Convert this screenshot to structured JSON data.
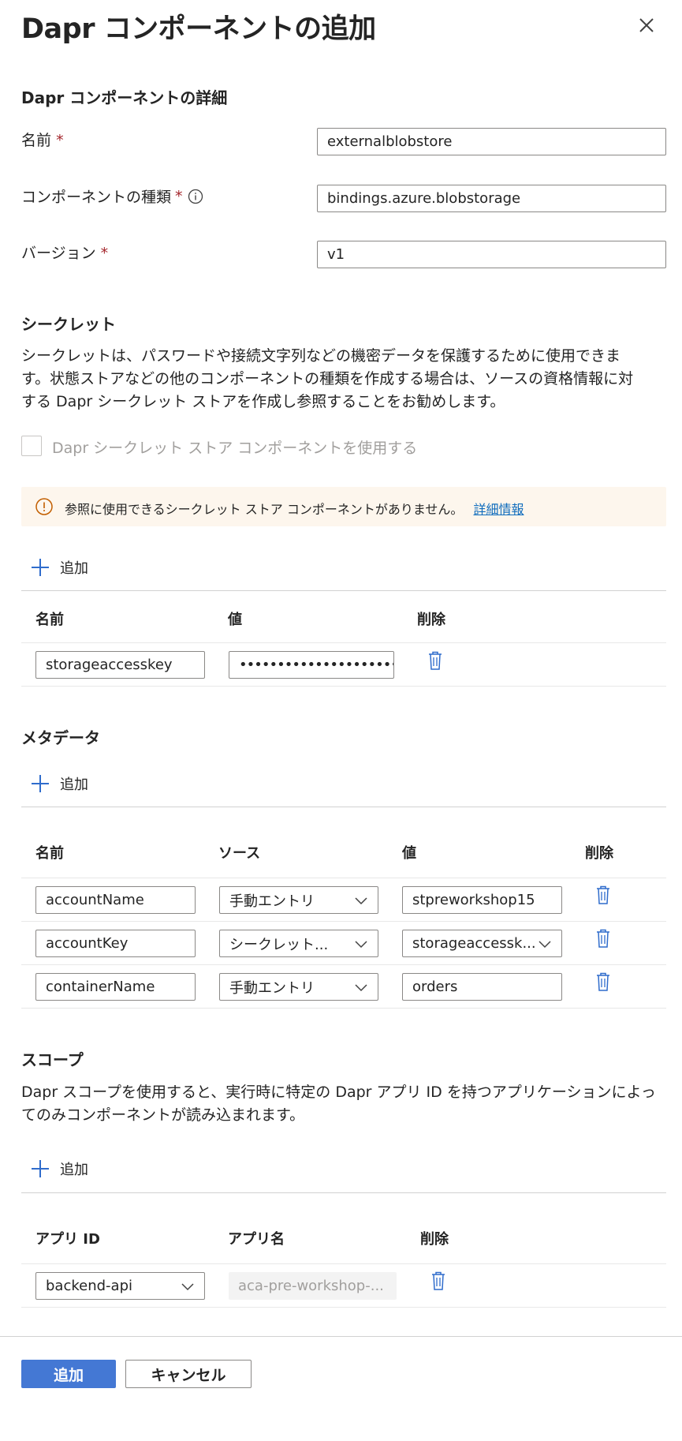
{
  "panel": {
    "title": "Dapr コンポーネントの追加"
  },
  "details": {
    "heading": "Dapr コンポーネントの詳細",
    "name_label": "名前",
    "name_value": "externalblobstore",
    "type_label": "コンポーネントの種類",
    "type_value": "bindings.azure.blobstorage",
    "version_label": "バージョン",
    "version_value": "v1",
    "required_mark": "*"
  },
  "secrets": {
    "heading": "シークレット",
    "desc_line1": "シークレットは、パスワードや接続文字列などの機密データを保護するために使用できま",
    "desc_line2": "す。状態ストアなどの他のコンポーネントの種類を作成する場合は、ソースの資格情報に対",
    "desc_line3": "する Dapr シークレット ストアを作成し参照することをお勧めします。",
    "checkbox_label": "Dapr シークレット ストア コンポーネントを使用する",
    "warning_text": "参照に使用できるシークレット ストア コンポーネントがありません。",
    "warning_link": "詳細情報",
    "add_label": "追加",
    "col_name": "名前",
    "col_value": "値",
    "col_delete": "削除",
    "rows": [
      {
        "name": "storageaccesskey",
        "value": "••••••••••••••••••••••..."
      }
    ]
  },
  "metadata": {
    "heading": "メタデータ",
    "add_label": "追加",
    "col_name": "名前",
    "col_source": "ソース",
    "col_value": "値",
    "col_delete": "削除",
    "rows": [
      {
        "name": "accountName",
        "source": "手動エントリ",
        "value": "stpreworkshop15"
      },
      {
        "name": "accountKey",
        "source": "シークレット...",
        "value": "storageaccessk..."
      },
      {
        "name": "containerName",
        "source": "手動エントリ",
        "value": "orders"
      }
    ]
  },
  "scope": {
    "heading": "スコープ",
    "desc_line1": "Dapr スコープを使用すると、実行時に特定の Dapr アプリ ID を持つアプリケーションによっ",
    "desc_line2": "てのみコンポーネントが読み込まれます。",
    "add_label": "追加",
    "col_app_id": "アプリ ID",
    "col_app_name": "アプリ名",
    "col_delete": "削除",
    "rows": [
      {
        "app_id": "backend-api",
        "app_name": "aca-pre-workshop-..."
      }
    ]
  },
  "footer": {
    "primary_label": "追加",
    "secondary_label": "キャンセル"
  },
  "colors": {
    "accent": "#4478d4",
    "link": "#0f6cbd",
    "required": "#a4262c",
    "warning_icon": "#c25e00",
    "warning_bg": "#fdf6ed"
  },
  "icons": [
    "close-icon",
    "info-icon",
    "warning-icon",
    "plus-icon",
    "trash-icon",
    "chevron-down-icon"
  ]
}
